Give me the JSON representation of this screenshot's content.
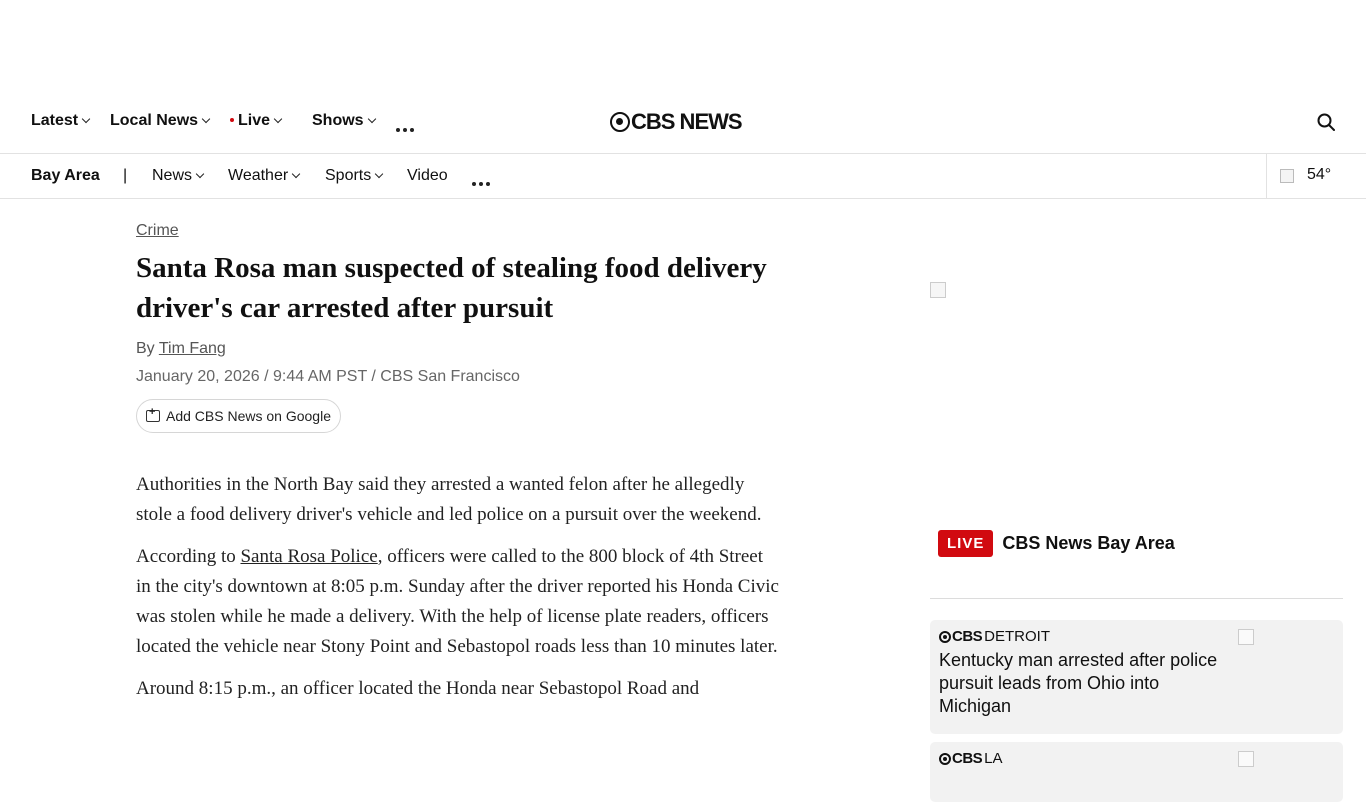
{
  "top_nav": {
    "latest": "Latest",
    "local_news": "Local News",
    "live": "Live",
    "shows": "Shows",
    "logo_text": "CBS NEWS"
  },
  "local_nav": {
    "region": "Bay Area",
    "separator": "|",
    "news": "News",
    "weather": "Weather",
    "sports": "Sports",
    "video": "Video",
    "temperature": "54°"
  },
  "article": {
    "category": "Crime",
    "headline": "Santa Rosa man suspected of stealing food delivery driver's car arrested after pursuit",
    "byline_prefix": "By",
    "author": "Tim Fang",
    "dateline": "January 20, 2026 / 9:44 AM PST / CBS San Francisco",
    "google_button": "Add CBS News on Google",
    "p1": "Authorities in the North Bay said they arrested a wanted felon after he allegedly stole a food delivery driver's vehicle and led police on a pursuit over the weekend.",
    "p2_pre": "According to ",
    "p2_link": "Santa Rosa Police",
    "p2_post": ", officers were called to the 800 block of 4th Street in the city's downtown at 8:05 p.m. Sunday after the driver reported his Honda Civic was stolen while he made a delivery. With the help of license plate readers, officers located the vehicle near Stony Point and Sebastopol roads less than 10 minutes later.",
    "p3": "Around 8:15 p.m., an officer located the Honda near Sebastopol Road and"
  },
  "sidebar": {
    "live_badge": "LIVE",
    "live_title": "CBS News Bay Area",
    "cards": [
      {
        "network": "CBS",
        "station": "DETROIT",
        "title": "Kentucky man arrested after police pursuit leads from Ohio into Michigan"
      },
      {
        "network": "CBS",
        "station": "LA",
        "title": ""
      }
    ]
  },
  "icons": {
    "search": "search-icon",
    "more": "more-dots-icon",
    "weather": "weather-icon",
    "google": "add-google-icon"
  },
  "colors": {
    "live_red": "#d10a10",
    "card_bg": "#f2f2f2"
  }
}
